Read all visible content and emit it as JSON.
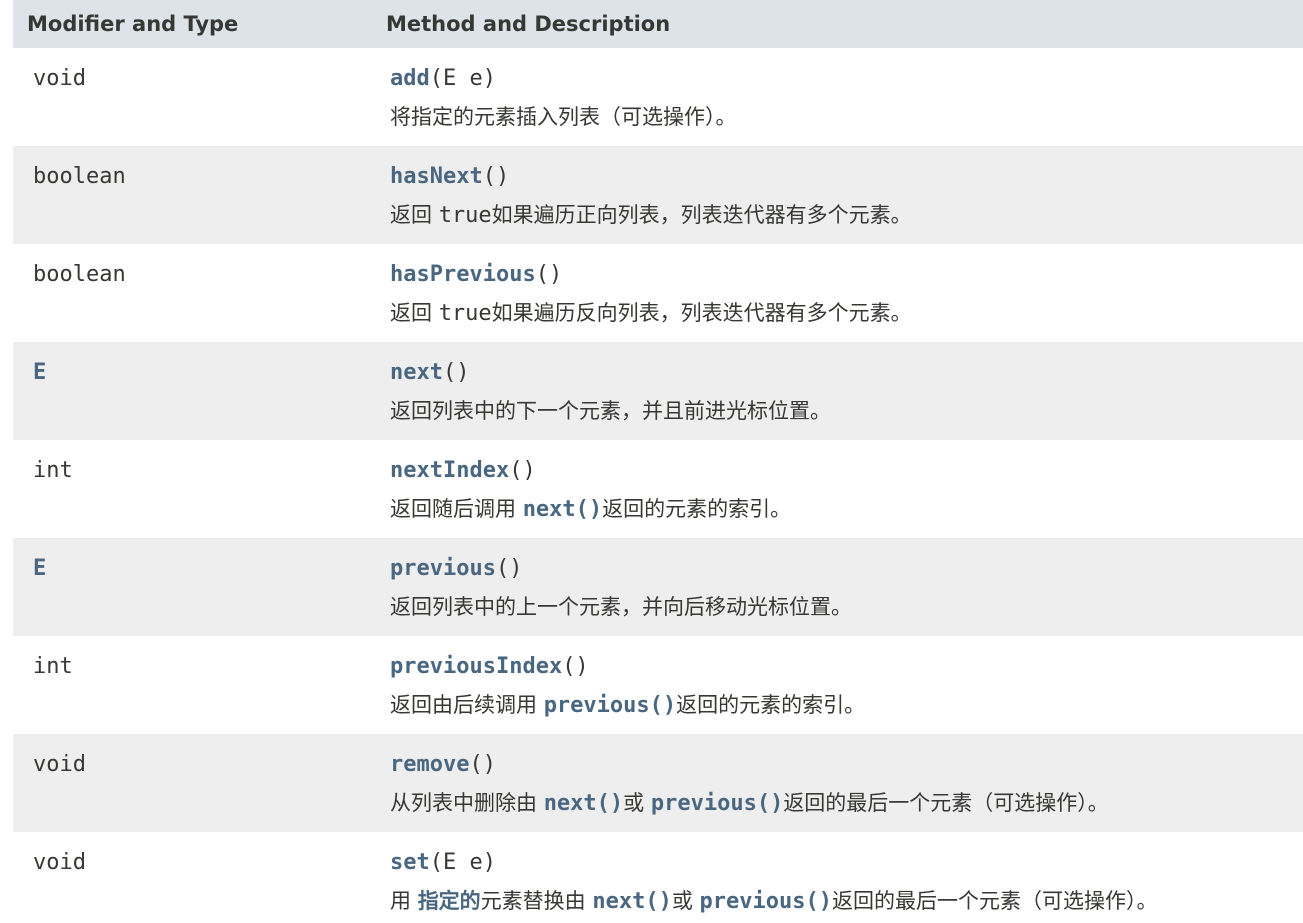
{
  "header": {
    "col_type": "Modifier and Type",
    "col_method": "Method and Description"
  },
  "colors": {
    "header_bg": "#dee3e9",
    "row_alt_bg": "#eeeeef",
    "link": "#4a6782",
    "text": "#353833"
  },
  "rows": [
    {
      "type": "void",
      "method_name": "add",
      "method_params": "(E e)",
      "desc": [
        {
          "t": "将指定的元素插入列表（可选操作）。"
        }
      ]
    },
    {
      "type": "boolean",
      "method_name": "hasNext",
      "method_params": "()",
      "desc": [
        {
          "t": "返回 "
        },
        {
          "t": "true"
        },
        {
          "t": "如果遍历正向列表，列表迭代器有多个元素。"
        }
      ]
    },
    {
      "type": "boolean",
      "method_name": "hasPrevious",
      "method_params": "()",
      "desc": [
        {
          "t": "返回 "
        },
        {
          "t": "true"
        },
        {
          "t": "如果遍历反向列表，列表迭代器有多个元素。"
        }
      ]
    },
    {
      "type": "E",
      "method_name": "next",
      "method_params": "()",
      "desc": [
        {
          "t": "返回列表中的下一个元素，并且前进光标位置。"
        }
      ]
    },
    {
      "type": "int",
      "method_name": "nextIndex",
      "method_params": "()",
      "desc": [
        {
          "t": "返回随后调用 "
        },
        {
          "t": "next()"
        },
        {
          "t": "返回的元素的索引。"
        }
      ]
    },
    {
      "type": "E",
      "method_name": "previous",
      "method_params": "()",
      "desc": [
        {
          "t": "返回列表中的上一个元素，并向后移动光标位置。"
        }
      ]
    },
    {
      "type": "int",
      "method_name": "previousIndex",
      "method_params": "()",
      "desc": [
        {
          "t": "返回由后续调用 "
        },
        {
          "t": "previous()"
        },
        {
          "t": "返回的元素的索引。"
        }
      ]
    },
    {
      "type": "void",
      "method_name": "remove",
      "method_params": "()",
      "desc": [
        {
          "t": "从列表中删除由 "
        },
        {
          "t": "next()"
        },
        {
          "t": "或 "
        },
        {
          "t": "previous()"
        },
        {
          "t": "返回的最后一个元素（可选操作）。"
        }
      ]
    },
    {
      "type": "void",
      "method_name": "set",
      "method_params": "(E e)",
      "desc": [
        {
          "t": "用 "
        },
        {
          "t": "指定的"
        },
        {
          "t": "元素替换由 "
        },
        {
          "t": "next()"
        },
        {
          "t": "或 "
        },
        {
          "t": "previous()"
        },
        {
          "t": "返回的最后一个元素（可选操作）。"
        }
      ]
    }
  ]
}
